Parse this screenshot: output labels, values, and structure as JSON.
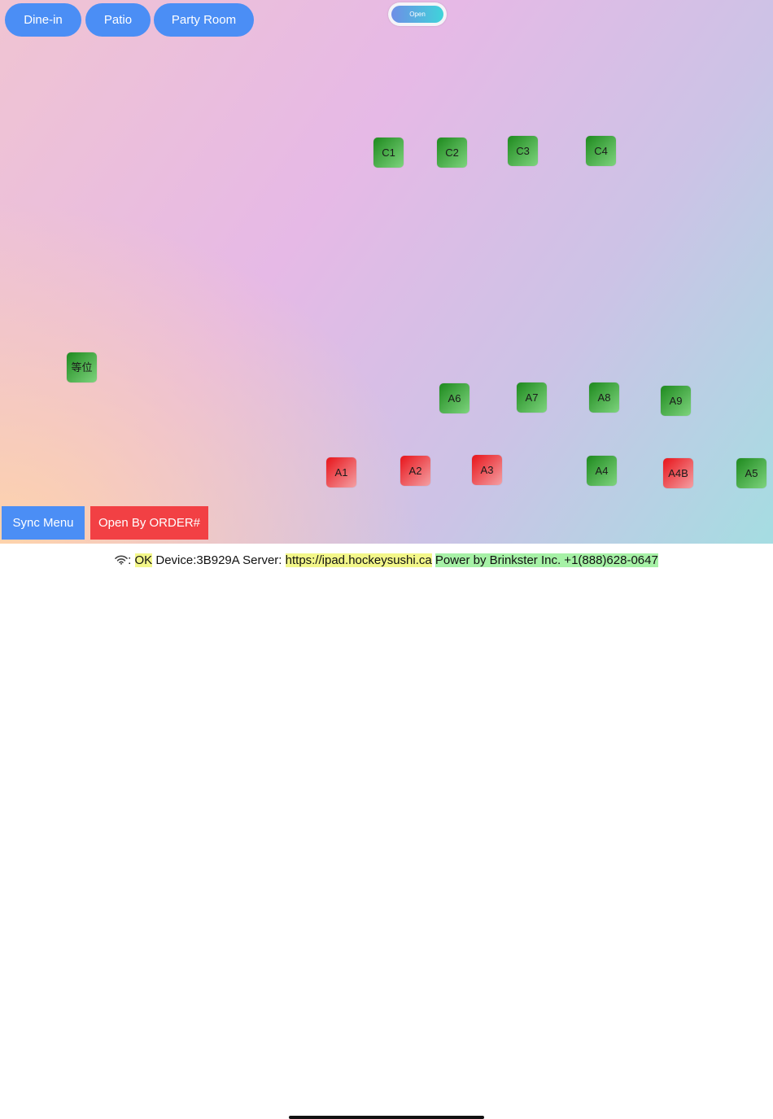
{
  "areas": [
    "Dine-in",
    "Patio",
    "Party Room"
  ],
  "toggle": {
    "label": "Open"
  },
  "tables": [
    {
      "label": "C1",
      "status": "open"
    },
    {
      "label": "C2",
      "status": "open"
    },
    {
      "label": "C3",
      "status": "open"
    },
    {
      "label": "C4",
      "status": "open"
    },
    {
      "label": "等位",
      "status": "open"
    },
    {
      "label": "A6",
      "status": "open"
    },
    {
      "label": "A7",
      "status": "open"
    },
    {
      "label": "A8",
      "status": "open"
    },
    {
      "label": "A9",
      "status": "open"
    },
    {
      "label": "A1",
      "status": "occupied"
    },
    {
      "label": "A2",
      "status": "occupied"
    },
    {
      "label": "A3",
      "status": "occupied"
    },
    {
      "label": "A4",
      "status": "open"
    },
    {
      "label": "A4B",
      "status": "occupied"
    },
    {
      "label": "A5",
      "status": "open"
    }
  ],
  "actions": {
    "sync_label": "Sync Menu",
    "open_order_label": "Open By ORDER#"
  },
  "status": {
    "wifi_icon": "wifi-icon",
    "colon": ":",
    "connection": "OK",
    "device_label": "Device:3B929A Server:",
    "server_url": "https://ipad.hockeysushi.ca",
    "powered_by": "Power by Brinkster Inc. +1(888)628-0647"
  },
  "colors": {
    "area_button": "#4b8ef5",
    "sync_button": "#4b8ef5",
    "order_button": "#f24044",
    "table_open": "#2e9a2e",
    "table_occupied": "#ee2026",
    "highlight_yellow": "#f3f78a",
    "highlight_green": "#a6f1a6"
  }
}
